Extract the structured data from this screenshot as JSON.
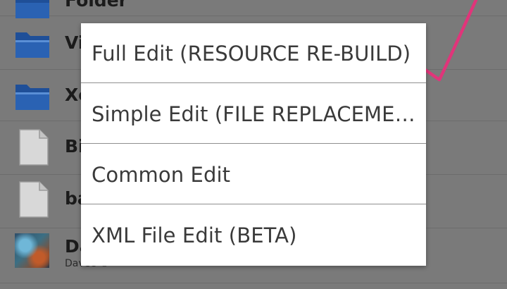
{
  "file_list": {
    "rows": [
      {
        "name": "Folder",
        "icon": "folder-icon"
      },
      {
        "name": "Vi",
        "icon": "folder-icon"
      },
      {
        "name": "Xo",
        "icon": "folder-icon"
      },
      {
        "name": "Bi",
        "icon": "file-icon"
      },
      {
        "name": "ba",
        "icon": "file-icon"
      },
      {
        "name": "Da",
        "subtitle": "Davee ©",
        "icon": "image-thumbnail"
      }
    ]
  },
  "dialog": {
    "items": [
      {
        "label": "Full Edit (RESOURCE RE-BUILD)"
      },
      {
        "label": "Simple Edit (FILE REPLACEMENT)"
      },
      {
        "label": "Common Edit"
      },
      {
        "label": "XML File Edit (BETA)"
      }
    ]
  },
  "colors": {
    "overlay_bg": "#7a7a7a",
    "dialog_bg": "#ffffff",
    "divider": "#8f8f8f",
    "text": "#3a3a3a",
    "folder_blue": "#1f4f98",
    "annotation_pink": "#e0357a"
  }
}
